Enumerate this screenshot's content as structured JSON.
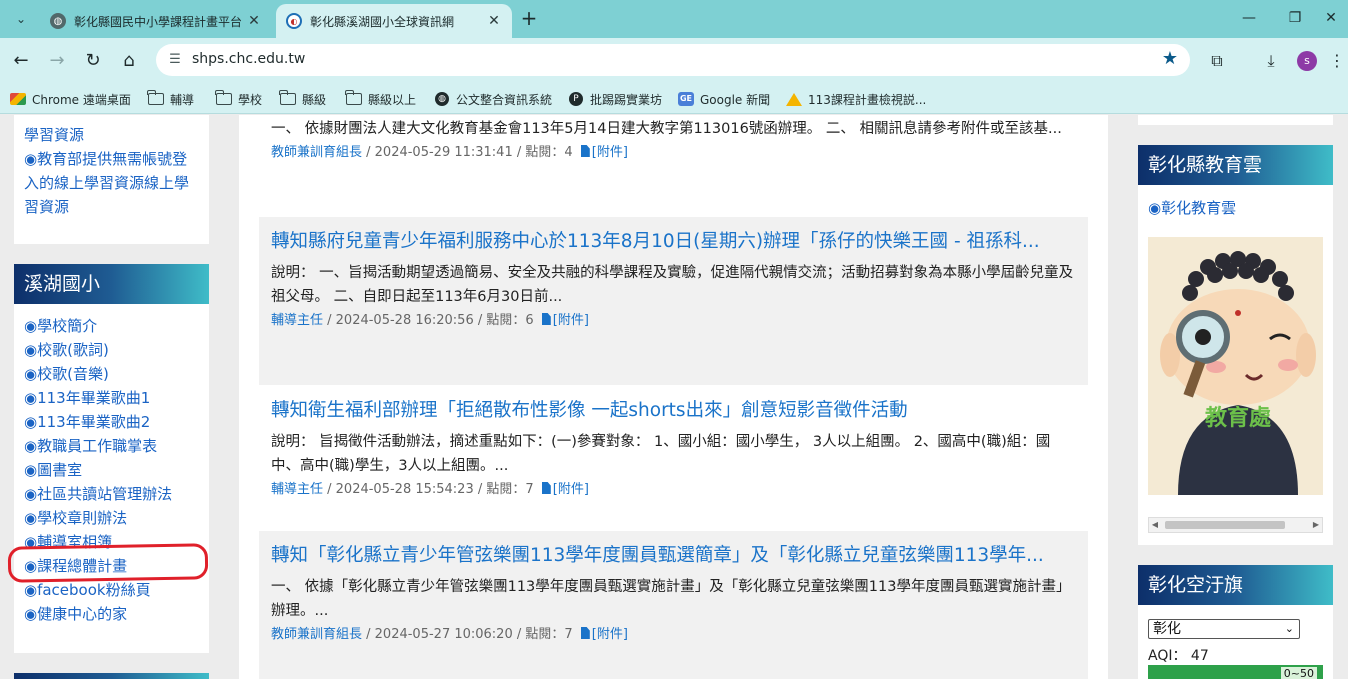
{
  "browser": {
    "tabs": [
      {
        "title": "彰化縣國民中小學課程計畫平台",
        "active": false
      },
      {
        "title": "彰化縣溪湖國小全球資訊網",
        "active": true
      }
    ],
    "url": "shps.chc.edu.tw",
    "profile_initial": "s",
    "bookmarks": [
      {
        "label": "Chrome 遠端桌面",
        "icon": "chrome-remote-desktop-icon"
      },
      {
        "label": "輔導",
        "icon": "folder-icon"
      },
      {
        "label": "學校",
        "icon": "folder-icon"
      },
      {
        "label": "縣級",
        "icon": "folder-icon"
      },
      {
        "label": "縣級以上",
        "icon": "folder-icon"
      },
      {
        "label": "公文整合資訊系統",
        "icon": "globe-icon"
      },
      {
        "label": "批踢踢實業坊",
        "icon": "p-icon"
      },
      {
        "label": "Google 新聞",
        "icon": "google-news-icon"
      },
      {
        "label": "113課程計畫檢視説...",
        "icon": "google-drive-icon"
      }
    ]
  },
  "left": {
    "top_links": [
      "學習資源",
      "◉教育部提供無需帳號登入的線上學習資源線上學習資源"
    ],
    "school_title": "溪湖國小",
    "school_links": [
      "◉學校簡介",
      "◉校歌(歌詞)",
      "◉校歌(音樂)",
      "◉113年畢業歌曲1",
      "◉113年畢業歌曲2",
      "◉教職員工作職掌表",
      "◉圖書室",
      "◉社區共讀站管理辦法",
      "◉學校章則辦法",
      "◉輔導室相簿",
      "◉課程總體計畫",
      "◉facebook粉絲頁",
      "◉健康中心的家"
    ]
  },
  "news": [
    {
      "title": "",
      "desc": "一、 依據財團法人建大文化教育基金會113年5月14日建大教字第113016號函辦理。 二、 相關訊息請參考附件或至該基...",
      "author": "教師兼訓育組長",
      "meta": " / 2024-05-29 11:31:41 / 點閱：4",
      "attach": "[附件]"
    },
    {
      "title": "轉知縣府兒童青少年福利服務中心於113年8月10日(星期六)辦理「孫仔的快樂王國 - 祖孫科...",
      "desc": "說明： 一、旨揭活動期望透過簡易、安全及共融的科學課程及實驗，促進隔代親情交流；活動招募對象為本縣小學屆齡兒童及祖父母。 二、自即日起至113年6月30日前...",
      "author": "輔導主任",
      "meta": " / 2024-05-28 16:20:56 / 點閱：6",
      "attach": "[附件]"
    },
    {
      "title": "轉知衛生福利部辦理「拒絕散布性影像 一起shorts出來」創意短影音徵件活動",
      "desc": "說明： 旨揭徵件活動辦法，摘述重點如下：(一)參賽對象： 1、國小組：國小學生， 3人以上組團。 2、國高中(職)組：國中、高中(職)學生，3人以上組團。...",
      "author": "輔導主任",
      "meta": " / 2024-05-28 15:54:23 / 點閱：7",
      "attach": "[附件]"
    },
    {
      "title": "轉知「彰化縣立青少年管弦樂團113學年度團員甄選簡章」及「彰化縣立兒童弦樂團113學年...",
      "desc": "一、 依據「彰化縣立青少年管弦樂團113學年度團員甄選實施計畫」及「彰化縣立兒童弦樂團113學年度團員甄選實施計畫」辦理。...",
      "author": "教師兼訓育組長",
      "meta": " / 2024-05-27 10:06:20 / 點閱：7",
      "attach": "[附件]"
    }
  ],
  "right": {
    "cloud_title": "彰化縣教育雲",
    "cloud_link": "◉彰化教育雲",
    "cloud_image_text": "教育處",
    "aqi_title": "彰化空汙旗",
    "aqi_select": "彰化",
    "aqi_label": "AQI： 47",
    "aqi_value": 47,
    "aqi_range": "0~50"
  },
  "colors": {
    "tabbar": "#7ed0d3",
    "toolbar": "#d4f1f2",
    "link": "#1a63c4",
    "news_title": "#1a73c9",
    "panel_head_start": "#0d2f6a",
    "panel_head_end": "#3fbcc8",
    "highlight_circle": "#e0202a",
    "aqi_good": "#2ea14a"
  }
}
